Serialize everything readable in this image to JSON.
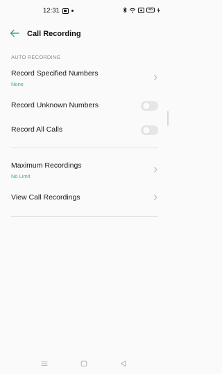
{
  "status_bar": {
    "time": "12:31",
    "battery": "46"
  },
  "header": {
    "title": "Call Recording"
  },
  "section": {
    "label": "AUTO RECORDING"
  },
  "settings": {
    "record_specified": {
      "title": "Record Specified Numbers",
      "value": "None"
    },
    "record_unknown": {
      "title": "Record Unknown Numbers",
      "enabled": false
    },
    "record_all": {
      "title": "Record All Calls",
      "enabled": false
    },
    "max_recordings": {
      "title": "Maximum Recordings",
      "value": "No Limit"
    },
    "view_recordings": {
      "title": "View Call Recordings"
    }
  },
  "colors": {
    "accent": "#35b36b",
    "back_arrow": "#3aa86b",
    "toggle_off": "#e6e6e6"
  },
  "icons": {
    "back": "arrow-left-icon",
    "chevron": "chevron-right-icon",
    "nav_menu": "menu-icon",
    "nav_home": "home-square-icon",
    "nav_back": "triangle-back-icon"
  }
}
